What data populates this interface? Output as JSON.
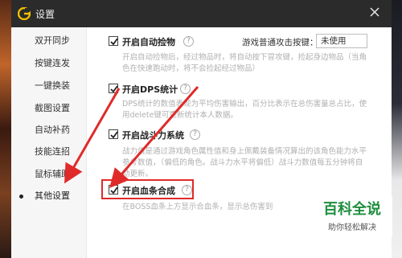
{
  "window": {
    "title": "设置"
  },
  "sidebar": {
    "items": [
      {
        "label": "双开同步"
      },
      {
        "label": "按键连发"
      },
      {
        "label": "一键换装"
      },
      {
        "label": "截图设置"
      },
      {
        "label": "自动补药"
      },
      {
        "label": "技能连招"
      },
      {
        "label": "鼠标辅助"
      },
      {
        "label": "其他设置",
        "active": true
      }
    ]
  },
  "options": {
    "auto_pickup": {
      "label": "开启自动捡物",
      "checked": true,
      "description": [
        "开启自动捡物后，经过物品时，将自动按下冒攻键，捡起身边物品（当角",
        "色在快速跑动时，将不会捡起经过物品）"
      ],
      "hotkey_label": "游戏普通攻击按键：",
      "hotkey_value": "未使用"
    },
    "dps_stats": {
      "label": "开启DPS统计",
      "checked": true,
      "description": [
        "DPS统计的数值表现为平均伤害输出，百分比表示在总伤害量总占比，使",
        "用delete键可重新统计本人数据。"
      ]
    },
    "power_system": {
      "label": "开启战斗力系统",
      "checked": true,
      "description": [
        "战力值是通过游戏角色属性值和身上佩戴装备情况算出的该角色能力水平",
        "参考数值，（偏低的角色。战斗力水平将偏低）战斗力数值每五分钟将自",
        "动更新。"
      ]
    },
    "blood_merge": {
      "label": "开启血条合成",
      "checked": true,
      "description": [
        "在BOSS血条上方显示合血条，显示总伤害到"
      ]
    }
  },
  "help_icon_glyph": "?",
  "watermark": {
    "title": "百科全说",
    "subtitle": "助你轻松解决"
  },
  "colors": {
    "highlight": "#e02a2a",
    "accent_green": "#1e8e3e",
    "titlebar": "#2b2b2b"
  }
}
